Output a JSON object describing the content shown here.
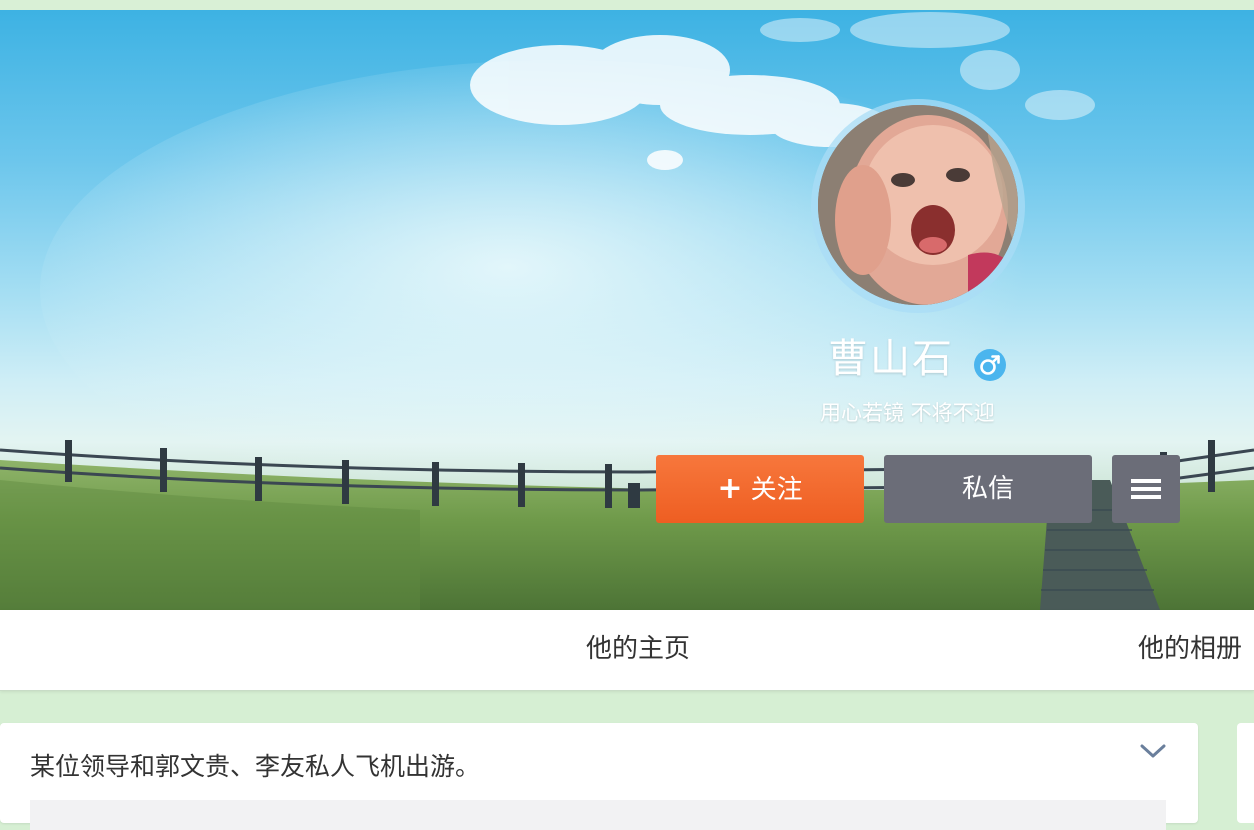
{
  "profile": {
    "username": "曹山石",
    "gender_icon": "male-gender-icon",
    "bio": "用心若镜 不将不迎",
    "avatar": "baby-photo-avatar"
  },
  "actions": {
    "follow_icon": "plus-icon",
    "follow_label": "关注",
    "message_label": "私信",
    "menu_icon": "hamburger-menu-icon"
  },
  "tabs": [
    {
      "label": "他的主页"
    },
    {
      "label": "他的相册"
    }
  ],
  "feed": {
    "post_text": "某位领导和郭文贵、李友私人飞机出游。",
    "expand_icon": "chevron-down-icon"
  },
  "colors": {
    "follow_button": "#ee5e22",
    "secondary_button": "#6b6d78",
    "gender_badge": "#4bb5ee",
    "page_background": "#d6efd3"
  }
}
